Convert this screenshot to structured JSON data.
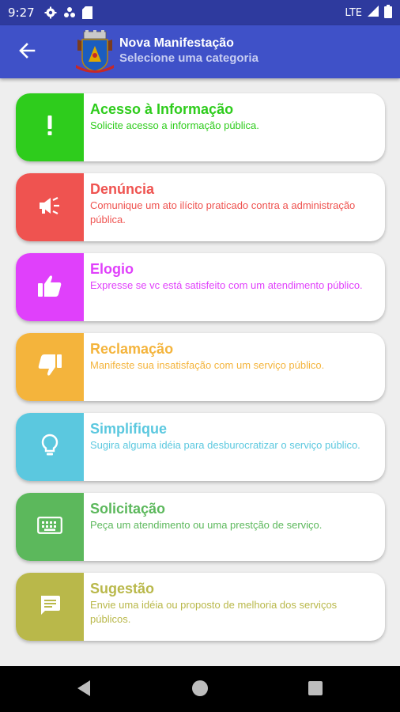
{
  "status_bar": {
    "time": "9:27",
    "network": "LTE",
    "icons": [
      "gear-icon",
      "fan-icon",
      "sd-card-icon",
      "signal-icon",
      "battery-icon"
    ]
  },
  "app_bar": {
    "title": "Nova Manifestação",
    "subtitle": "Selecione uma categoria",
    "back_icon": "arrow-left-icon",
    "logo_icon": "city-crest-icon",
    "background": "#3f51c8"
  },
  "categories": [
    {
      "title": "Acesso à Informação",
      "description": "Solicite acesso a informação pública.",
      "color": "#2ecc1c",
      "icon": "exclamation-icon"
    },
    {
      "title": "Denúncia",
      "description": "Comunique um ato ilícito praticado contra a administração pública.",
      "color": "#ef5350",
      "icon": "megaphone-icon"
    },
    {
      "title": "Elogio",
      "description": "Expresse se vc está satisfeito com um atendimento público.",
      "color": "#e040fb",
      "icon": "thumbs-up-icon"
    },
    {
      "title": "Reclamação",
      "description": "Manifeste sua insatisfação com um serviço público.",
      "color": "#f4b43c",
      "icon": "thumbs-down-icon"
    },
    {
      "title": "Simplifique",
      "description": "Sugira alguma idéia para desburocratizar o serviço público.",
      "color": "#5bc8df",
      "icon": "lightbulb-icon"
    },
    {
      "title": "Solicitação",
      "description": "Peça um atendimento ou uma prestção de serviço.",
      "color": "#5cb85c",
      "icon": "keyboard-icon"
    },
    {
      "title": "Sugestão",
      "description": "Envie uma idéia ou proposto de melhoria dos serviços públicos.",
      "color": "#b9b84a",
      "icon": "comment-icon"
    }
  ],
  "nav_bar": {
    "icons": [
      "back-triangle-icon",
      "home-circle-icon",
      "recents-square-icon"
    ]
  }
}
